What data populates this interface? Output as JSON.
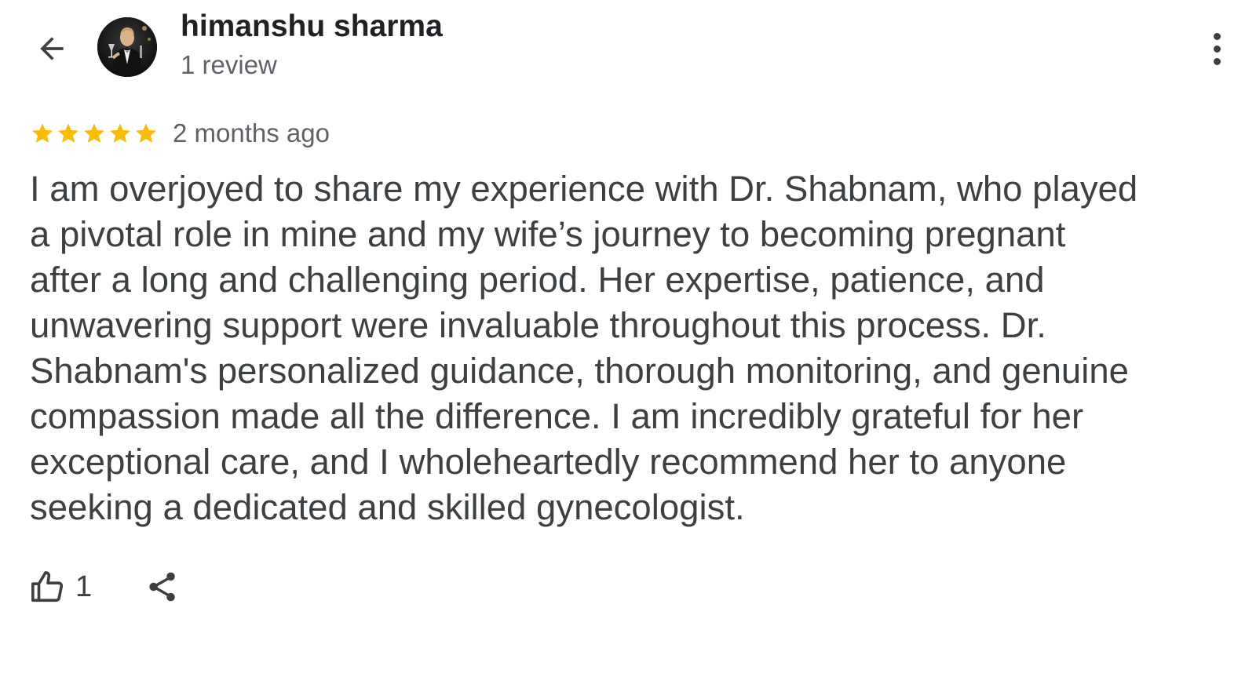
{
  "header": {
    "back_icon": "arrow-back-icon",
    "avatar_alt": "profile-photo",
    "reviewer_name": "himanshu sharma",
    "review_count": "1 review",
    "more_icon": "more-vert-icon"
  },
  "review": {
    "rating": 5,
    "rating_max": 5,
    "star_color": "#fbbc04",
    "time_ago": "2 months ago",
    "text_lines": [
      "I am overjoyed to share my experience with Dr. Shabnam, who played",
      "a pivotal role in mine and my wife’s journey to becoming pregnant",
      "after a long and challenging period. Her expertise, patience, and",
      "unwavering support were invaluable throughout this process. Dr.",
      "Shabnam's personalized guidance, thorough monitoring, and genuine",
      "compassion made all the difference. I am incredibly grateful for her",
      "exceptional care, and I wholeheartedly recommend her to anyone",
      "seeking a dedicated and skilled gynecologist."
    ]
  },
  "actions": {
    "like_icon": "thumb-up-icon",
    "like_count": "1",
    "share_icon": "share-icon"
  },
  "colors": {
    "primary_text": "#202124",
    "body_text": "#3c4043",
    "secondary_text": "#5f6368",
    "star": "#fbbc04"
  }
}
